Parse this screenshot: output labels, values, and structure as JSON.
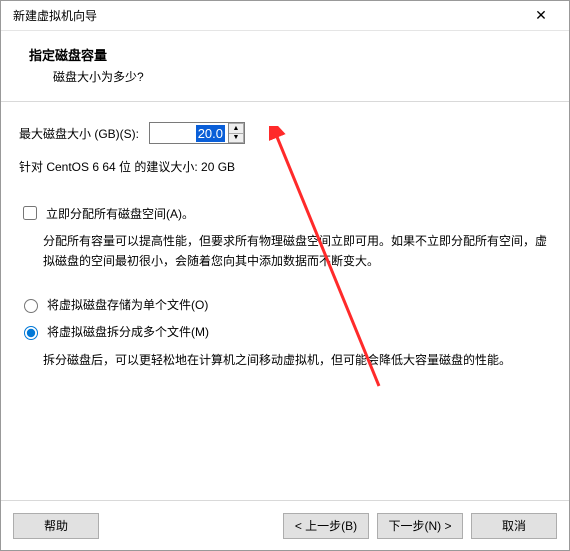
{
  "window": {
    "title": "新建虚拟机向导"
  },
  "header": {
    "title": "指定磁盘容量",
    "subtitle": "磁盘大小为多少?"
  },
  "disk": {
    "label": "最大磁盘大小 (GB)(S):",
    "value": "20.0",
    "recommendation": "针对 CentOS 6 64 位 的建议大小: 20 GB"
  },
  "allocate": {
    "label": "立即分配所有磁盘空间(A)。",
    "desc": "分配所有容量可以提高性能，但要求所有物理磁盘空间立即可用。如果不立即分配所有空间，虚拟磁盘的空间最初很小，会随着您向其中添加数据而不断变大。"
  },
  "store": {
    "single": "将虚拟磁盘存储为单个文件(O)",
    "split": "将虚拟磁盘拆分成多个文件(M)",
    "split_desc": "拆分磁盘后，可以更轻松地在计算机之间移动虚拟机，但可能会降低大容量磁盘的性能。"
  },
  "buttons": {
    "help": "帮助",
    "back": "< 上一步(B)",
    "next": "下一步(N) >",
    "cancel": "取消"
  }
}
